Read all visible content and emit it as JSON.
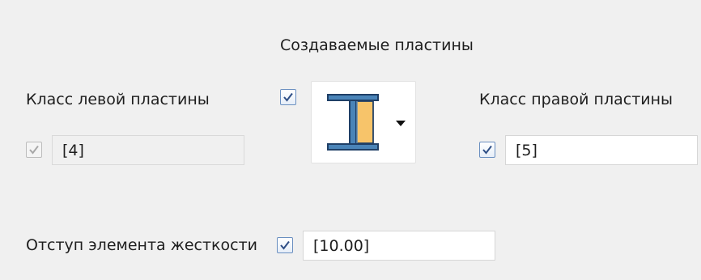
{
  "created_plates": {
    "title": "Создаваемые пластины",
    "enabled": true,
    "profile_icon": "i-beam-plates-icon",
    "accent_color": "#f7c46a"
  },
  "left_plate": {
    "title": "Класс левой пластины",
    "checked": true,
    "disabled": true,
    "value": "[4]"
  },
  "right_plate": {
    "title": "Класс правой пластины",
    "checked": true,
    "value": "[5]"
  },
  "stiffener_offset": {
    "title": "Отступ элемента жесткости",
    "checked": true,
    "value": "[10.00]"
  }
}
